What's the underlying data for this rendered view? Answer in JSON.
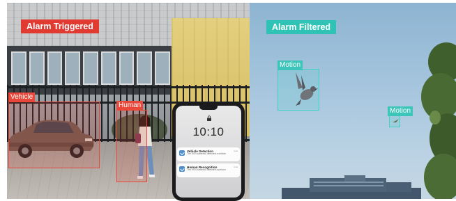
{
  "left_panel": {
    "alarm_label": "Alarm Triggered",
    "detections": [
      {
        "id": "vehicle",
        "label": "Vehicle"
      },
      {
        "id": "human",
        "label": "Human"
      }
    ],
    "color": "#e03a31"
  },
  "right_panel": {
    "alarm_label": "Alarm Filtered",
    "detections": [
      {
        "id": "motion-bird",
        "label": "Motion"
      },
      {
        "id": "motion-small",
        "label": "Motion"
      }
    ],
    "color": "#2fc3b5"
  },
  "phone": {
    "time": "10:10",
    "notifications": [
      {
        "title": "Vehicle Detection",
        "body": "The VIGI camera1 detected a vehicle",
        "time": "now"
      },
      {
        "title": "Human Recognition",
        "body": "The VIGI camera1 detected a person",
        "time": "now"
      }
    ]
  }
}
